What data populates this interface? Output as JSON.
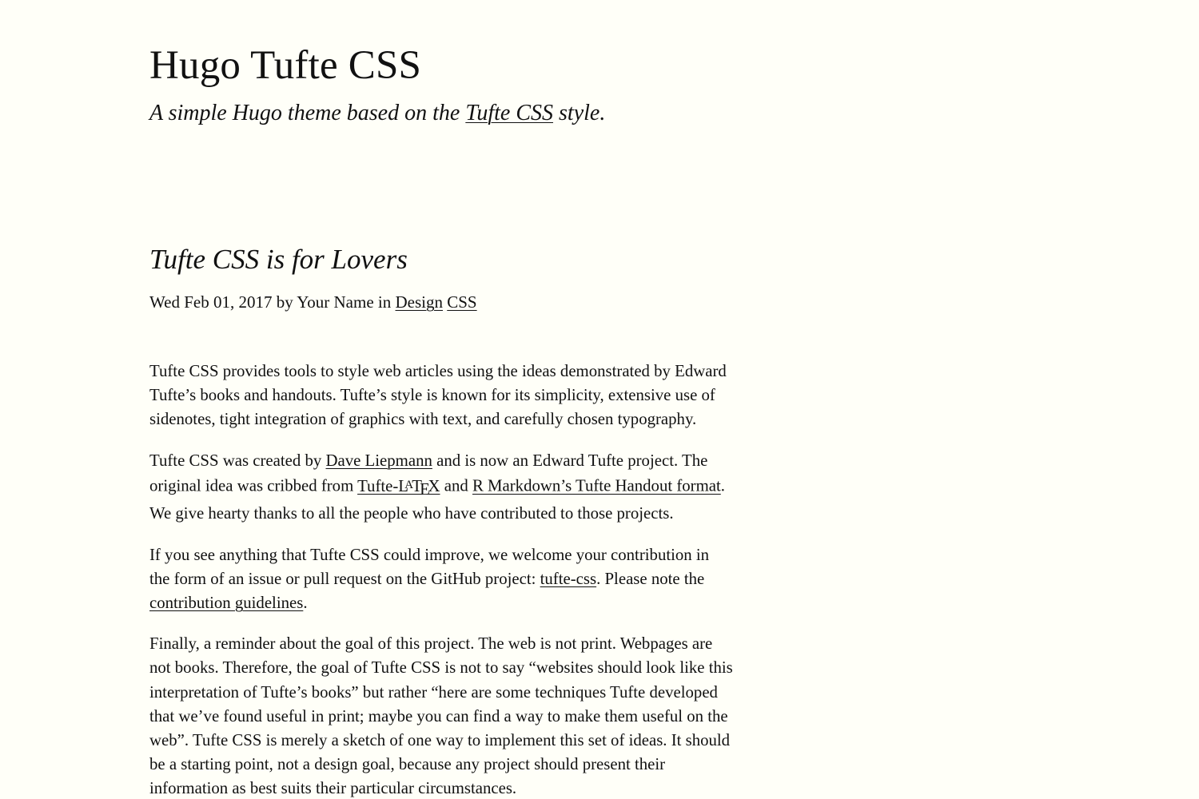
{
  "site": {
    "title": "Hugo Tufte CSS",
    "tagline": {
      "before": "A simple Hugo theme based on the ",
      "link": "Tufte CSS",
      "after": " style."
    }
  },
  "post": {
    "title": "Tufte CSS is for Lovers",
    "meta": {
      "date": "Wed Feb 01, 2017",
      "by": " by ",
      "author": "Your Name",
      "in": " in ",
      "categories": [
        "Design",
        "CSS"
      ]
    },
    "paragraphs": {
      "p1": {
        "text": "Tufte CSS provides tools to style web articles using the ideas demonstrated by Edward Tufte’s books and handouts. Tufte’s style is known for its simplicity, extensive use of sidenotes, tight integration of graphics with text, and carefully chosen typography."
      },
      "p2": {
        "t1": "Tufte CSS was created by ",
        "link1": "Dave Liepmann",
        "t2": " and is now an Edward Tufte project. The original idea was cribbed from ",
        "link2_prefix": "Tufte-L",
        "link2_a": "A",
        "link2_t": "T",
        "link2_e": "E",
        "link2_x": "X",
        "t3": " and ",
        "link3": "R Markdown’s Tufte Handout format",
        "t4": ". We give hearty thanks to all the people who have contributed to those projects."
      },
      "p3": {
        "t1": "If you see anything that Tufte CSS could improve, we welcome your contribution in the form of an issue or pull request on the GitHub project: ",
        "link1": "tufte-css",
        "t2": ". Please note the ",
        "link2": "contribution guidelines",
        "t3": "."
      },
      "p4": {
        "text": "Finally, a reminder about the goal of this project. The web is not print. Webpages are not books. Therefore, the goal of Tufte CSS is not to say “websites should look like this interpretation of Tufte’s books” but rather “here are some techniques Tufte developed that we’ve found useful in print; maybe you can find a way to make them useful on the web”. Tufte CSS is merely a sketch of one way to implement this set of ideas. It should be a starting point, not a design goal, because any project should present their information as best suits their particular circumstances."
      }
    }
  }
}
